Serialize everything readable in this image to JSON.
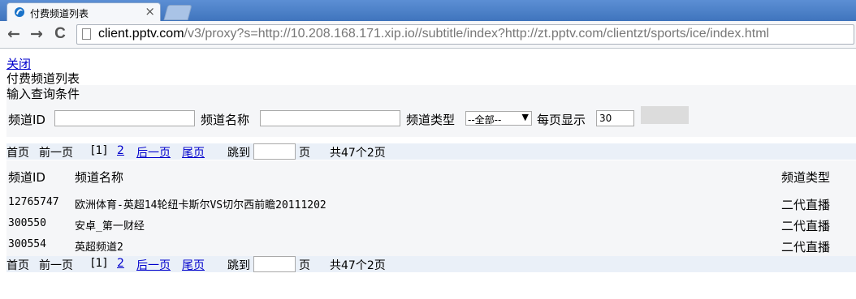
{
  "browser": {
    "tab_title": "付费频道列表",
    "close_tab_glyph": "×",
    "url_host": "client.pptv.com",
    "url_rest": "/v3/proxy?s=http://10.208.168.171.xip.io//subtitle/index?http://zt.pptv.com/clientzt/sports/ice/index.html",
    "back_glyph": "←",
    "forward_glyph": "→",
    "reload_glyph": "C"
  },
  "page": {
    "close_link": "关闭",
    "heading": "付费频道列表",
    "query": {
      "title": "输入查询条件",
      "channel_id_label": "频道ID",
      "channel_id_value": "",
      "channel_name_label": "频道名称",
      "channel_name_value": "",
      "channel_type_label": "频道类型",
      "channel_type_selected": "--全部--",
      "per_page_label": "每页显示",
      "per_page_value": "30",
      "search_button_label": ""
    },
    "pager": {
      "first": "首页",
      "prev": "前一页",
      "current": "[1]",
      "page2": "2",
      "next": "后一页",
      "last": "尾页",
      "jump_to": "跳到",
      "page_unit": "页",
      "summary": "共47个2页"
    },
    "table": {
      "columns": [
        "频道ID",
        "频道名称",
        "频道类型"
      ],
      "rows": [
        {
          "id": "12765747",
          "name": "欧洲体育-英超14轮纽卡斯尔VS切尔西前瞻20111202",
          "type": "二代直播"
        },
        {
          "id": "300550",
          "name": "安卓_第一财经",
          "type": "二代直播"
        },
        {
          "id": "300554",
          "name": "英超频道2",
          "type": "二代直播"
        }
      ]
    }
  },
  "icons": {
    "favicon": "pptv-swirl-icon",
    "page": "page-icon"
  },
  "colors": {
    "link": "#0000cc",
    "pager_bg": "#eaf0f8",
    "panel_bg": "#f5f6f8",
    "tabbar": "#4f83c8"
  }
}
